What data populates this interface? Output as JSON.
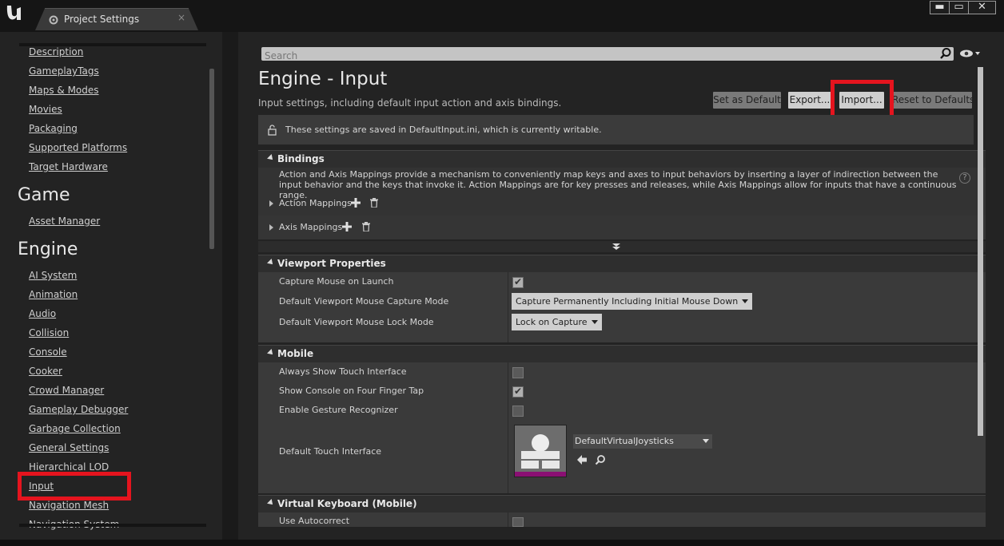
{
  "window": {
    "tab_title": "Project Settings",
    "tab_close": "×",
    "buttons": {
      "minimize": "▬",
      "maximize": "▭",
      "close": "✕"
    }
  },
  "sidebar": {
    "items_top": [
      "Description",
      "GameplayTags",
      "Maps & Modes",
      "Movies",
      "Packaging",
      "Supported Platforms",
      "Target Hardware"
    ],
    "game_heading": "Game",
    "game_items": [
      "Asset Manager"
    ],
    "engine_heading": "Engine",
    "engine_items": [
      "AI System",
      "Animation",
      "Audio",
      "Collision",
      "Console",
      "Cooker",
      "Crowd Manager",
      "Gameplay Debugger",
      "Garbage Collection",
      "General Settings",
      "Hierarchical LOD",
      "Input",
      "Navigation Mesh",
      "Navigation System"
    ],
    "highlighted": "Input"
  },
  "header": {
    "search_placeholder": "Search",
    "title": "Engine - Input",
    "subtitle": "Input settings, including default input action and axis bindings.",
    "buttons": {
      "set_default": "Set as Default",
      "export": "Export...",
      "import": "Import...",
      "reset": "Reset to Defaults"
    },
    "notice": "These settings are saved in DefaultInput.ini, which is currently writable."
  },
  "bindings": {
    "title": "Bindings",
    "description": "Action and Axis Mappings provide a mechanism to conveniently map keys and axes to input behaviors by inserting a layer of indirection between the input behavior and the keys that invoke it. Action Mappings are for key presses and releases, while Axis Mappings allow for inputs that have a continuous range.",
    "help": "?",
    "action_mappings": "Action Mappings",
    "axis_mappings": "Axis Mappings"
  },
  "viewport": {
    "title": "Viewport Properties",
    "capture_on_launch": {
      "label": "Capture Mouse on Launch",
      "checked": true
    },
    "capture_mode": {
      "label": "Default Viewport Mouse Capture Mode",
      "value": "Capture Permanently Including Initial Mouse Down"
    },
    "lock_mode": {
      "label": "Default Viewport Mouse Lock Mode",
      "value": "Lock on Capture"
    }
  },
  "mobile": {
    "title": "Mobile",
    "always_show_touch": {
      "label": "Always Show Touch Interface",
      "checked": false
    },
    "console_four_finger": {
      "label": "Show Console on Four Finger Tap",
      "checked": true
    },
    "gesture_recognizer": {
      "label": "Enable Gesture Recognizer",
      "checked": false
    },
    "touch_interface": {
      "label": "Default Touch Interface",
      "value": "DefaultVirtualJoysticks"
    }
  },
  "virtual_keyboard": {
    "title": "Virtual Keyboard (Mobile)",
    "autocorrect": {
      "label": "Use Autocorrect",
      "checked": false
    }
  },
  "colors": {
    "highlight": "#e5141e",
    "panel": "#232323",
    "row": "#3a3a3a"
  }
}
